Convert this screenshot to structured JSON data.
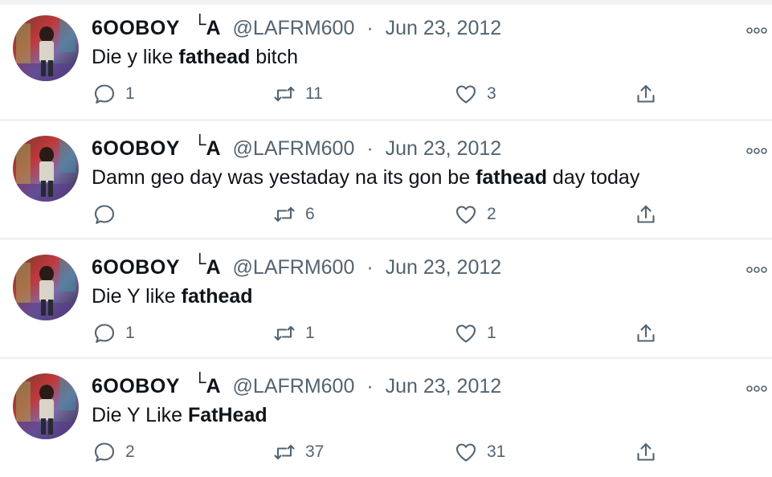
{
  "tweets": [
    {
      "name": "6OOBOY",
      "mark_a": "└",
      "mark_b": "A",
      "handle": "@LAFRM600",
      "sep": "·",
      "date": "Jun 23, 2012",
      "text_before": "Die y like ",
      "text_bold": "fathead",
      "text_after": " bitch",
      "replies": "1",
      "retweets": "11",
      "likes": "3"
    },
    {
      "name": "6OOBOY",
      "mark_a": "└",
      "mark_b": "A",
      "handle": "@LAFRM600",
      "sep": "·",
      "date": "Jun 23, 2012",
      "text_before": "Damn geo day was yestaday na its gon be ",
      "text_bold": "fathead",
      "text_after": " day today",
      "replies": "",
      "retweets": "6",
      "likes": "2"
    },
    {
      "name": "6OOBOY",
      "mark_a": "└",
      "mark_b": "A",
      "handle": "@LAFRM600",
      "sep": "·",
      "date": "Jun 23, 2012",
      "text_before": "Die Y like ",
      "text_bold": "fathead",
      "text_after": "",
      "replies": "1",
      "retweets": "1",
      "likes": "1"
    },
    {
      "name": "6OOBOY",
      "mark_a": "└",
      "mark_b": "A",
      "handle": "@LAFRM600",
      "sep": "·",
      "date": "Jun 23, 2012",
      "text_before": "Die Y Like ",
      "text_bold": "FatHead",
      "text_after": "",
      "replies": "2",
      "retweets": "37",
      "likes": "31"
    }
  ],
  "icons": {
    "reply": "reply-icon",
    "retweet": "retweet-icon",
    "like": "heart-icon",
    "share": "share-icon",
    "more": "more-icon"
  },
  "colors": {
    "text": "#0f1419",
    "secondary": "#536471",
    "divider": "#eff3f4",
    "background": "#ffffff"
  }
}
